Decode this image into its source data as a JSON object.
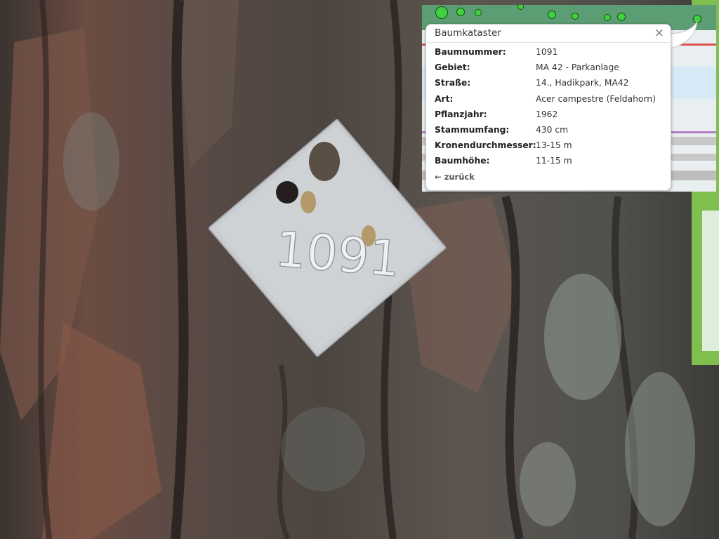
{
  "photo": {
    "tag_number": "1091",
    "colors": {
      "bark_dark": "#3e3834",
      "bark_mid": "#5a524c",
      "bark_red": "#8a5a4a",
      "lichen": "#8f9a93",
      "foliage": "#7fbf4f",
      "tag": "#c9ccd0"
    }
  },
  "map": {
    "colors": {
      "header": "#5c9d73",
      "dot": "#3fd13f",
      "dot_border": "#145214",
      "water": "#d6e9f7",
      "route": "#b07cc6"
    }
  },
  "popup": {
    "title": "Baumkataster",
    "close_icon": "×",
    "back_label": "← zurück",
    "rows": [
      {
        "label": "Baumnummer:",
        "value": "1091"
      },
      {
        "label": "Gebiet:",
        "value": "MA 42 - Parkanlage"
      },
      {
        "label": "Straße:",
        "value": "14., Hadikpark, MA42"
      },
      {
        "label": "Art:",
        "value": "Acer campestre (Feldahorn)"
      },
      {
        "label": "Pflanzjahr:",
        "value": "1962"
      },
      {
        "label": "Stammumfang:",
        "value": "430 cm"
      },
      {
        "label": "Kronendurchmesser:",
        "value": "13-15 m"
      },
      {
        "label": "Baumhöhe:",
        "value": "11-15 m"
      }
    ]
  }
}
